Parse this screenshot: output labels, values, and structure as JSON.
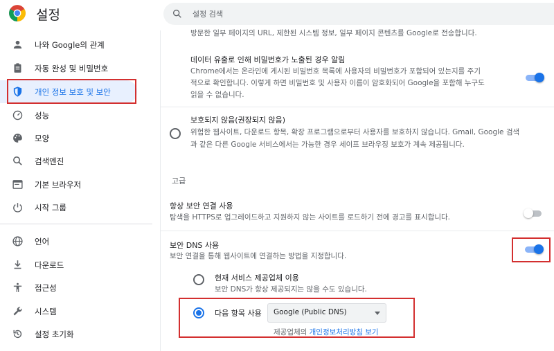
{
  "header": {
    "title": "설정",
    "search_placeholder": "설정 검색",
    "logo_icon": "chrome-logo-icon",
    "search_icon": "search-icon"
  },
  "sidebar": {
    "items": [
      {
        "label": "나와 Google의 관계",
        "icon": "person-icon"
      },
      {
        "label": "자동 완성 및 비밀번호",
        "icon": "clipboard-icon"
      },
      {
        "label": "개인 정보 보호 및 보안",
        "icon": "shield-icon",
        "active": true
      },
      {
        "label": "성능",
        "icon": "speedometer-icon"
      },
      {
        "label": "모양",
        "icon": "palette-icon"
      },
      {
        "label": "검색엔진",
        "icon": "search-icon"
      },
      {
        "label": "기본 브라우저",
        "icon": "browser-icon"
      },
      {
        "label": "시작 그룹",
        "icon": "power-icon"
      },
      {
        "label": "언어",
        "icon": "globe-icon"
      },
      {
        "label": "다운로드",
        "icon": "download-icon"
      },
      {
        "label": "접근성",
        "icon": "accessibility-icon"
      },
      {
        "label": "시스템",
        "icon": "wrench-icon"
      },
      {
        "label": "설정 초기화",
        "icon": "restore-icon"
      }
    ]
  },
  "main": {
    "top_text": "방문한 일부 페이지의 URL, 제한된 시스템 정보, 일부 페이지 콘텐츠를 Google로 전송합니다.",
    "leak_alert": {
      "title": "데이터 유출로 인해 비밀번호가 노출된 경우 알림",
      "desc_line1": "Chrome에서는 온라인에 게시된 비밀번호 목록에 사용자의 비밀번호가 포함되어 있는지를 주기",
      "desc_line2": "적으로 확인합니다. 이렇게 하면 비밀번호 및 사용자 이름이 암호화되어 Google을 포함해 누구도",
      "desc_line3": "읽을 수 없습니다.",
      "enabled": true
    },
    "no_protection": {
      "title": "보호되지 않음(권장되지 않음)",
      "desc_line1": "위험한 웹사이트, 다운로드 항목, 확장 프로그램으로부터 사용자를 보호하지 않습니다. Gmail, Google 검색",
      "desc_line2": "과 같은 다른 Google 서비스에서는 가능한 경우 세이프 브라우징 보호가 계속 제공됩니다.",
      "selected": false
    },
    "advanced_heading": "고급",
    "always_secure": {
      "title": "항상 보안 연결 사용",
      "desc": "탐색을 HTTPS로 업그레이드하고 지원하지 않는 사이트를 로드하기 전에 경고를 표시합니다.",
      "enabled": false
    },
    "secure_dns": {
      "title": "보안 DNS 사용",
      "desc": "보안 연결을 통해 웹사이트에 연결하는 방법을 지정합니다.",
      "enabled": true,
      "option_current": {
        "title": "현재 서비스 제공업체 이용",
        "desc": "보안 DNS가 항상 제공되지는 않을 수도 있습니다.",
        "selected": false
      },
      "option_custom": {
        "label": "다음 항목 사용",
        "selected": true,
        "provider_value": "Google (Public DNS)"
      },
      "privacy_prefix": "제공업체의 ",
      "privacy_link": "개인정보처리방침 보기"
    }
  },
  "colors": {
    "accent": "#1a73e8",
    "highlight_box": "#d32f2f",
    "active_bg": "#e8f0fe"
  }
}
